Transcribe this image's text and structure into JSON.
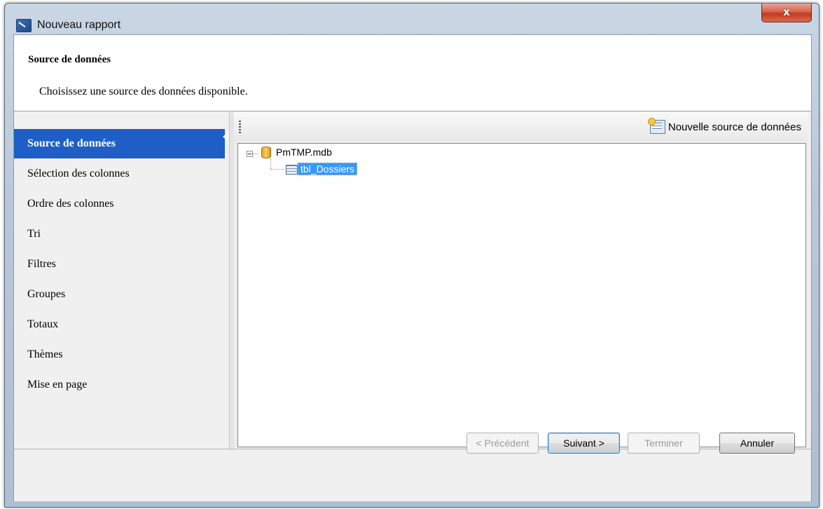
{
  "window": {
    "title": "Nouveau rapport",
    "close_label": "x"
  },
  "header": {
    "title": "Source de données",
    "subtitle": "Choisissez une source des données disponible."
  },
  "nav": {
    "items": [
      {
        "label": "Source de données",
        "active": true
      },
      {
        "label": "Sélection des colonnes",
        "active": false
      },
      {
        "label": "Ordre des colonnes",
        "active": false
      },
      {
        "label": "Tri",
        "active": false
      },
      {
        "label": "Filtres",
        "active": false
      },
      {
        "label": "Groupes",
        "active": false
      },
      {
        "label": "Totaux",
        "active": false
      },
      {
        "label": "Thèmes",
        "active": false
      },
      {
        "label": "Mise en page",
        "active": false
      }
    ]
  },
  "toolbar": {
    "new_source_label": "Nouvelle source de données",
    "new_source_icon": "new-data-source-icon"
  },
  "tree": {
    "root": {
      "label": "PmTMP.mdb",
      "icon": "database-icon",
      "expanded": true
    },
    "children": [
      {
        "label": "tbl_Dossiers",
        "icon": "table-icon",
        "selected": true
      }
    ]
  },
  "footer": {
    "prev_label": "< Précédent",
    "next_label": "Suivant >",
    "finish_label": "Terminer",
    "cancel_label": "Annuler"
  },
  "colors": {
    "selection": "#1e5ec6",
    "tree_selection": "#3399ff",
    "close_button": "#c23a1f"
  }
}
